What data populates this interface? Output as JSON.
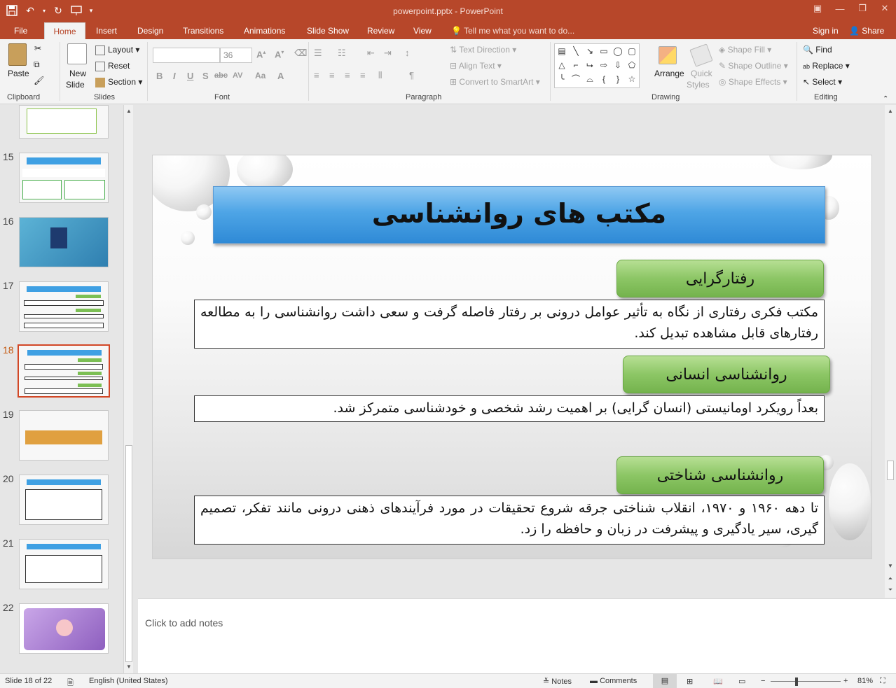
{
  "window": {
    "title": "powerpoint.pptx - PowerPoint",
    "accent": "#b7472a"
  },
  "tabs": [
    {
      "label": "File"
    },
    {
      "label": "Home"
    },
    {
      "label": "Insert"
    },
    {
      "label": "Design"
    },
    {
      "label": "Transitions"
    },
    {
      "label": "Animations"
    },
    {
      "label": "Slide Show"
    },
    {
      "label": "Review"
    },
    {
      "label": "View"
    }
  ],
  "tellme": "Tell me what you want to do...",
  "signin": "Sign in",
  "share": "Share",
  "ribbon": {
    "clipboard": {
      "paste": "Paste",
      "label": "Clipboard"
    },
    "slides": {
      "new_slide_1": "New",
      "new_slide_2": "Slide",
      "layout": "Layout",
      "reset": "Reset",
      "section": "Section",
      "label": "Slides"
    },
    "font": {
      "size": "36",
      "label": "Font",
      "bold": "B",
      "italic": "I",
      "underline": "U",
      "shadow": "S",
      "strike": "abc",
      "spacing": "AV",
      "case": "Aa"
    },
    "paragraph": {
      "text_direction": "Text Direction",
      "align_text": "Align Text",
      "smartart": "Convert to SmartArt",
      "label": "Paragraph"
    },
    "drawing": {
      "arrange": "Arrange",
      "quick_styles_1": "Quick",
      "quick_styles_2": "Styles",
      "shape_fill": "Shape Fill",
      "shape_outline": "Shape Outline",
      "shape_effects": "Shape Effects",
      "label": "Drawing"
    },
    "editing": {
      "find": "Find",
      "replace": "Replace",
      "select": "Select",
      "label": "Editing"
    }
  },
  "thumbnails": [
    {
      "num": "15"
    },
    {
      "num": "16"
    },
    {
      "num": "17"
    },
    {
      "num": "18",
      "selected": true
    },
    {
      "num": "19"
    },
    {
      "num": "20"
    },
    {
      "num": "21"
    },
    {
      "num": "22"
    }
  ],
  "slide": {
    "title": "مکتب های روانشناسی",
    "sections": [
      {
        "heading": "رفتارگرایی",
        "body": "مکتب فکری رفتاری از نگاه به تأثیر عوامل درونی بر رفتار فاصله گرفت و سعی داشت روانشناسی را به مطالعه رفتارهای قابل مشاهده تبدیل کند."
      },
      {
        "heading": "روانشناسی انسانی",
        "body": "بعداً رویکرد اومانیستی (انسان گرایی) بر اهمیت رشد شخصی و خودشناسی متمرکز شد."
      },
      {
        "heading": "روانشناسی شناختی",
        "body": "تا دهه ۱۹۶۰ و ۱۹۷۰، انقلاب شناختی جرقه شروع تحقیقات در مورد فرآیندهای ذهنی درونی مانند تفکر، تصمیم گیری، سیر یادگیری و پیشرفت در زبان و حافظه را زد."
      }
    ]
  },
  "notes_placeholder": "Click to add notes",
  "status": {
    "slide_info": "Slide 18 of 22",
    "language": "English (United States)",
    "notes": "Notes",
    "comments": "Comments",
    "zoom": "81%"
  }
}
